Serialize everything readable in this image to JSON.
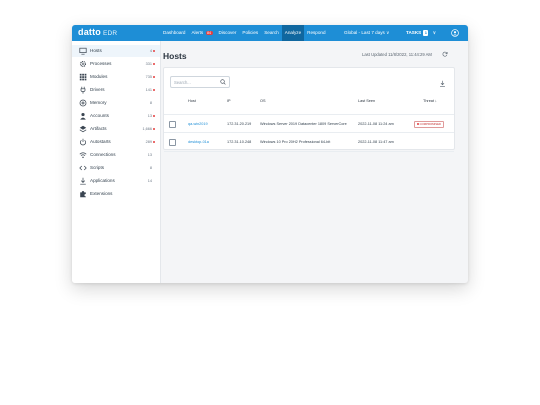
{
  "app": {
    "brand": "datto",
    "product": "EDR"
  },
  "nav": {
    "items": [
      "Dashboard",
      "Alerts",
      "Discover",
      "Policies",
      "Search",
      "Analyze",
      "Respond"
    ],
    "alerts_badge": "84",
    "active": "Analyze",
    "tenant": "Global - Last 7 days ∨",
    "tasks_label": "TASKS",
    "tasks_count": "1",
    "tasks_chevron": "∨"
  },
  "sidebar": {
    "items": [
      {
        "label": "Hosts",
        "count": "4",
        "icon": "monitor-icon",
        "alert": true
      },
      {
        "label": "Processes",
        "count": "331",
        "icon": "gear-icon",
        "alert": true
      },
      {
        "label": "Modules",
        "count": "735",
        "icon": "grid-icon",
        "alert": true
      },
      {
        "label": "Drivers",
        "count": "141",
        "icon": "plug-icon",
        "alert": true
      },
      {
        "label": "Memory",
        "count": "8",
        "icon": "memory-icon",
        "alert": false
      },
      {
        "label": "Accounts",
        "count": "13",
        "icon": "user-icon",
        "alert": true
      },
      {
        "label": "Artifacts",
        "count": "1,666",
        "icon": "layers-icon",
        "alert": true
      },
      {
        "label": "Autostarts",
        "count": "289",
        "icon": "power-icon",
        "alert": true
      },
      {
        "label": "Connections",
        "count": "13",
        "icon": "wifi-icon",
        "alert": false
      },
      {
        "label": "Scripts",
        "count": "8",
        "icon": "code-icon",
        "alert": false
      },
      {
        "label": "Applications",
        "count": "14",
        "icon": "download-icon",
        "alert": false
      },
      {
        "label": "Extensions",
        "count": "",
        "icon": "puzzle-icon",
        "alert": false
      }
    ]
  },
  "main": {
    "title": "Hosts",
    "last_updated": "Last Updated 11/8/2022, 11:44:29 AM",
    "search_placeholder": "Search...",
    "columns": [
      "Host",
      "IP",
      "OS",
      "Last Seen",
      "Threat ↓"
    ],
    "rows": [
      {
        "host": "qa-win2019",
        "ip": "172.31.20.219",
        "os": "Windows Server 2019 Datacenter 1809 ServerCore",
        "last_seen": "2022-11-08 11:24 am",
        "threat": "COMPROMISED"
      },
      {
        "host": "desktop-01a",
        "ip": "172.31.10.248",
        "os": "Windows 10 Pro 20H2 Professional 64-bit",
        "last_seen": "2022-11-08 11:47 am",
        "threat": ""
      }
    ]
  },
  "colors": {
    "accent": "#1e8ed6",
    "nav_active": "#10679f",
    "alert": "#e53e3e"
  }
}
